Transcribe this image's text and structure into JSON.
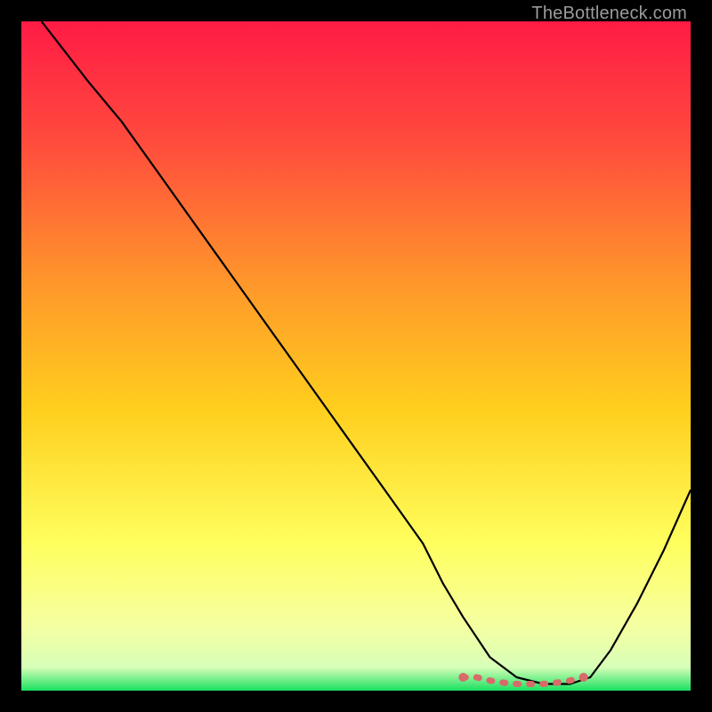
{
  "watermark": "TheBottleneck.com",
  "chart_data": {
    "type": "line",
    "title": "",
    "xlabel": "",
    "ylabel": "",
    "xlim": [
      0,
      100
    ],
    "ylim": [
      0,
      100
    ],
    "grid": false,
    "legend": false,
    "background_gradient": {
      "top_color": "#ff1b45",
      "mid_color": "#ffd21b",
      "lower_color": "#ffff86",
      "bottom_color": "#18e060"
    },
    "series": [
      {
        "name": "curve",
        "color": "#000000",
        "x": [
          3,
          10,
          15,
          20,
          25,
          30,
          35,
          40,
          45,
          50,
          55,
          60,
          63,
          66,
          70,
          74,
          78,
          82,
          85,
          88,
          92,
          96,
          100
        ],
        "y": [
          100,
          91,
          85,
          78,
          71,
          64,
          57,
          50,
          43,
          36,
          29,
          22,
          16,
          11,
          5,
          2,
          1,
          1,
          2,
          6,
          13,
          21,
          30
        ]
      },
      {
        "name": "highlight-band",
        "color": "#d86a6a",
        "type": "scatter",
        "x": [
          66,
          68,
          70,
          72,
          74,
          76,
          78,
          80,
          82,
          84
        ],
        "y": [
          2,
          2,
          1.5,
          1.2,
          1,
          1,
          1,
          1.2,
          1.5,
          2
        ]
      }
    ]
  }
}
